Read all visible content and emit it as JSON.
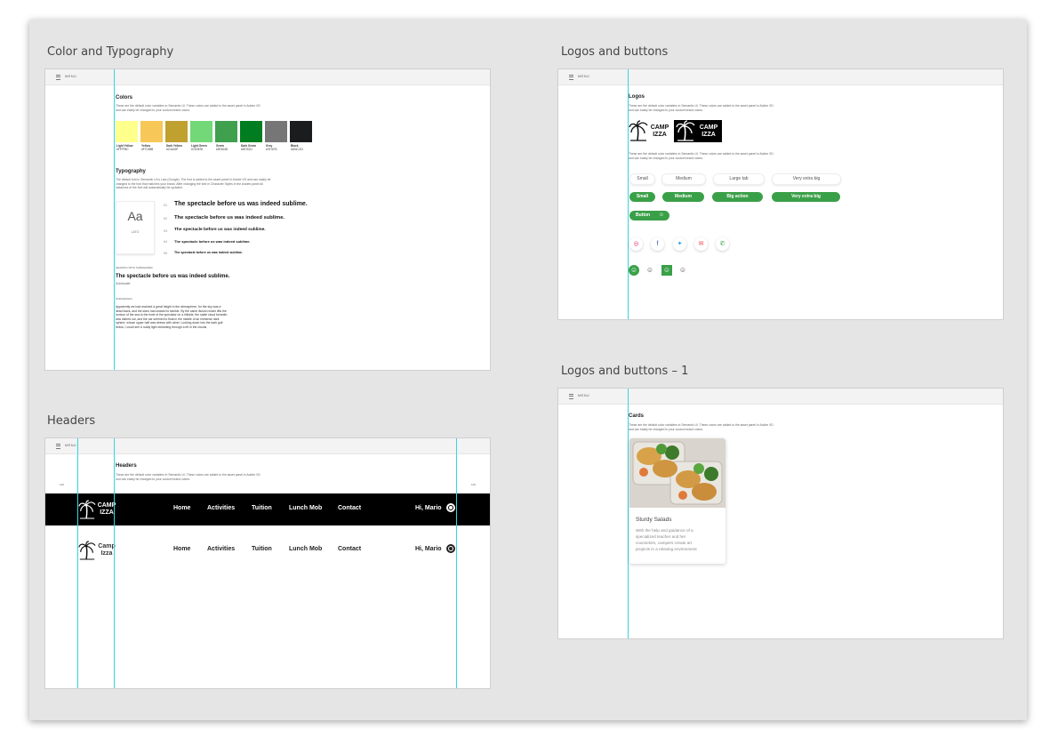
{
  "boards": {
    "color_typography": {
      "title": "Color and Typography"
    },
    "logos_buttons": {
      "title": "Logos and buttons"
    },
    "headers": {
      "title": "Headers"
    },
    "logos_buttons_1": {
      "title": "Logos and buttons – 1"
    }
  },
  "menu_label": "MENU",
  "colors_section": {
    "heading": "Colors",
    "desc1": "These are the default color variables in Semantic UI. These colors are added to the asset panel in Adobe XD",
    "desc2": "and can easily be changed to your custom brand colors.",
    "swatches": [
      {
        "name": "Light Yellow",
        "hex": "#FFFF8C",
        "color": "#ffff8c"
      },
      {
        "name": "Yellow",
        "hex": "#F7C858",
        "color": "#f7c858"
      },
      {
        "name": "Dark Yellow",
        "hex": "#C0A02F",
        "color": "#c0a02f"
      },
      {
        "name": "Light Green",
        "hex": "#72D878",
        "color": "#72d878"
      },
      {
        "name": "Green",
        "hex": "#3FA04D",
        "color": "#3fa04d"
      },
      {
        "name": "Dark Green",
        "hex": "#007D21",
        "color": "#007d21"
      },
      {
        "name": "Grey",
        "hex": "#767676",
        "color": "#767676"
      },
      {
        "name": "Black",
        "hex": "#1B1C1D",
        "color": "#1b1c1d"
      }
    ]
  },
  "typography": {
    "heading": "Typography",
    "desc1": "The default font in Semantic UI is Lato (Google). The font is added to the asset panel in Adobe XD and can easily be",
    "desc2": "changed to the font that matches your brand. After changing the font in Character Styles in the Assets panel all",
    "desc3": "instances of the font will automatically be updated.",
    "card_sample": "Aa",
    "card_font": "LATO",
    "levels": [
      "H1",
      "H2",
      "H3",
      "H4",
      "H5"
    ],
    "sample": "The spectacle before us was indeed sublime.",
    "heading_subheader_label": "HEADING WITH SUBHEADER",
    "heading_subheader": "The spectacle before us was indeed sublime.",
    "subheader": "Subheader",
    "paragraph_label": "PARAGRAPH",
    "paragraph": [
      "Apparently we had reached a great height in the atmosphere, for the sky was a",
      "dead black, and the stars had ceased to twinkle. By the same illusion which lifts the",
      "horizon of the sea to the level of the spectator on a hillside, the sable cloud beneath",
      "was dished out, and the car seemed to float in the middle of an immense dark",
      "sphere, whose upper half was strewn with silver. Looking down into the dark gulf",
      "below, I could see a ruddy light streaming through a rift in the clouds."
    ]
  },
  "logos": {
    "heading": "Logos",
    "desc1": "These are the default color variables in Semantic UI. These colors are added to the asset panel in Adobe XD",
    "desc2": "and can easily be changed to your custom brand colors.",
    "logo_line1": "CAMP",
    "logo_line2": "IZZA",
    "desc3": "These are the default color variables in Semantic UI. These colors are added to the asset panel in Adobe XD",
    "desc4": "and can easily be changed to your custom brand colors.",
    "outline_buttons": [
      "Small",
      "Medium",
      "Large tab",
      "Very extra big"
    ],
    "green_buttons": [
      "Small",
      "Medium",
      "Big action",
      "Very extra big"
    ],
    "icon_button": "Button",
    "social_icons": [
      "instagram-icon",
      "facebook-icon",
      "twitter-icon",
      "mail-icon",
      "phone-icon"
    ],
    "smiley_icons": [
      "smiley-icon",
      "smiley-icon",
      "smiley-icon",
      "smiley-icon"
    ]
  },
  "headers_section": {
    "heading": "Headers",
    "desc1": "These are the default color variables in Semantic UI. These colors are added to the asset panel in Adobe XD",
    "desc2": "and can easily be changed to your custom brand colors.",
    "col_left": "120",
    "col_right": "120",
    "nav": [
      "Home",
      "Activities",
      "Tuition",
      "Lunch Mob",
      "Contact"
    ],
    "greeting": "Hi, Mario",
    "logo_dark_1": "CAMP",
    "logo_dark_2": "IZZA",
    "logo_light_1": "Camp",
    "logo_light_2": "Izza"
  },
  "cards": {
    "heading": "Cards",
    "desc1": "These are the default color variables in Semantic UI. These colors are added to the asset panel in Adobe XD",
    "desc2": "and can easily be changed to your custom brand colors.",
    "card_title": "Sturdy Salads",
    "card_text": [
      "With the help and guidance of a",
      "specialized teacher and her",
      "counselors, campers create art",
      "projects in a relaxing environment"
    ]
  }
}
